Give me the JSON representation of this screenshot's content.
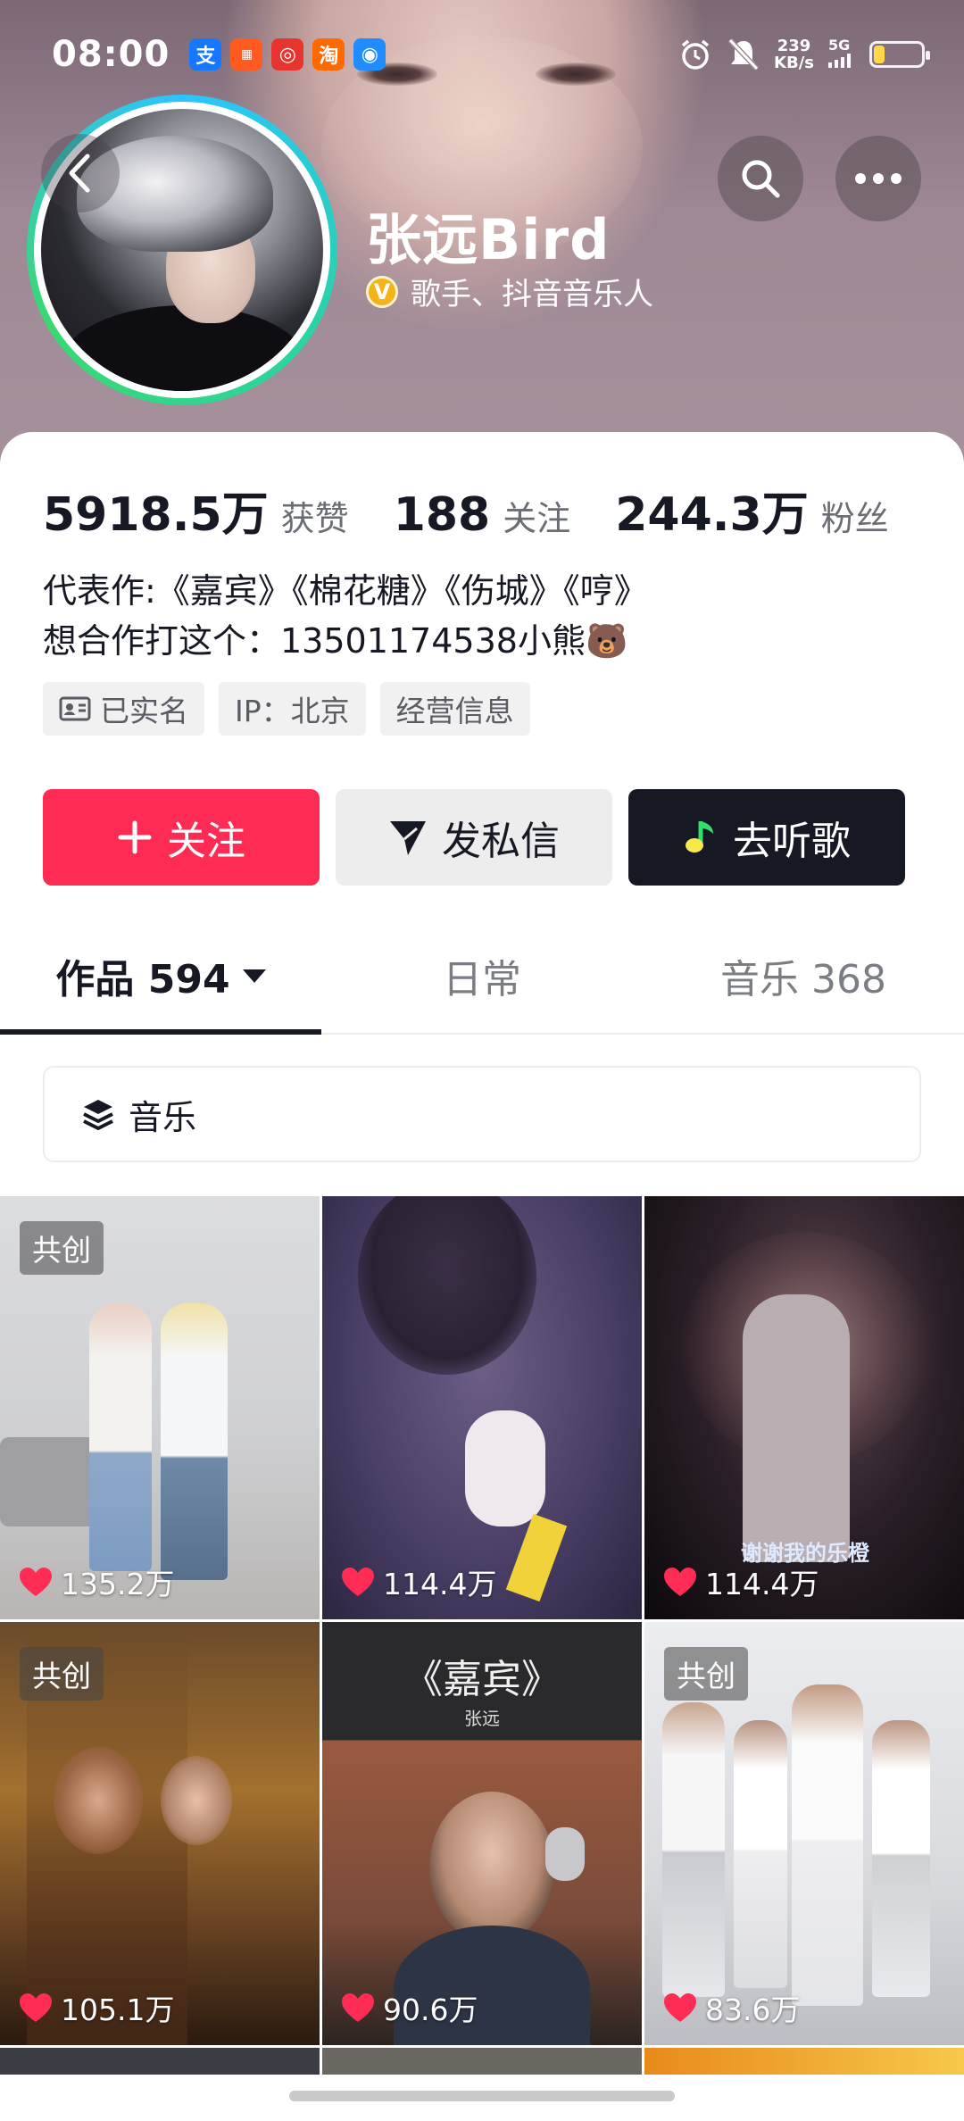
{
  "status_bar": {
    "time": "08:00",
    "apps": [
      "支",
      "淘",
      "◉"
    ],
    "speed_value": "239",
    "speed_unit": "KB/s",
    "network": "5G"
  },
  "profile": {
    "name": "张远Bird",
    "verified_badge": "V",
    "title": "歌手、抖音音乐人"
  },
  "stats": [
    {
      "value": "5918.5万",
      "label": "获赞"
    },
    {
      "value": "188",
      "label": "关注"
    },
    {
      "value": "244.3万",
      "label": "粉丝"
    }
  ],
  "bio": {
    "line1": "代表作:《嘉宾》《棉花糖》《伤城》《哼》",
    "line2": "想合作打这个：13501174538小熊🐻"
  },
  "chips": {
    "verified": "已实名",
    "ip": "IP：北京",
    "business": "经营信息"
  },
  "actions": {
    "follow": "关注",
    "message": "发私信",
    "listen": "去听歌"
  },
  "tabs": {
    "works": "作品 594",
    "daily": "日常",
    "music": "音乐 368"
  },
  "filter": {
    "label": "音乐"
  },
  "videos": [
    {
      "tag": "共创",
      "likes": "135.2万"
    },
    {
      "tag": "",
      "likes": "114.4万"
    },
    {
      "tag": "",
      "likes": "114.4万",
      "caption": "谢谢我的乐橙"
    },
    {
      "tag": "共创",
      "likes": "105.1万"
    },
    {
      "tag": "",
      "likes": "90.6万",
      "title": "《嘉宾》",
      "subtitle": "张远"
    },
    {
      "tag": "共创",
      "likes": "83.6万"
    }
  ],
  "colors": {
    "accent": "#fe2c55",
    "dark": "#161823"
  }
}
